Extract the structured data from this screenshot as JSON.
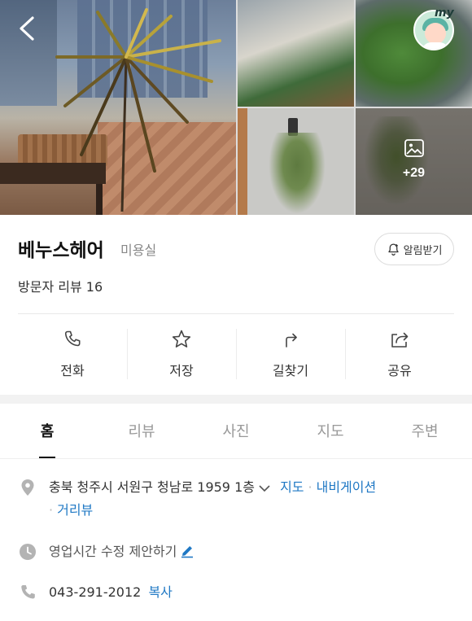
{
  "header": {
    "back_icon": "chevron-left-icon",
    "avatar_badge": "my",
    "more_photos_count": "+29"
  },
  "place": {
    "name": "베누스헤어",
    "category": "미용실",
    "notify_label": "알림받기",
    "visitor_reviews": "방문자 리뷰 16"
  },
  "actions": [
    {
      "label": "전화",
      "icon": "phone-icon"
    },
    {
      "label": "저장",
      "icon": "star-icon"
    },
    {
      "label": "길찾기",
      "icon": "directions-icon"
    },
    {
      "label": "공유",
      "icon": "share-icon"
    }
  ],
  "tabs": [
    "홈",
    "리뷰",
    "사진",
    "지도",
    "주변"
  ],
  "active_tab": "홈",
  "details": {
    "address": "충북 청주시 서원구 청남로 1959 1층",
    "map_link": "지도",
    "navigation_link": "내비게이션",
    "streetview_link": "거리뷰",
    "hours_text": "영업시간 수정 제안하기",
    "phone": "043-291-2012",
    "copy_link": "복사"
  },
  "colors": {
    "link": "#1f78c4",
    "icon_gray": "#aaaaaa",
    "divider": "#f2f2f2"
  }
}
